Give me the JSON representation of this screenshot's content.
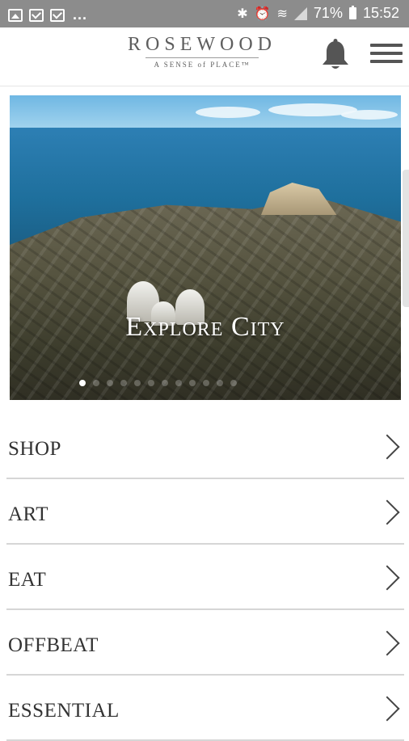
{
  "status_bar": {
    "more": "...",
    "battery": "71%",
    "time": "15:52"
  },
  "header": {
    "logo_main": "ROSEWOOD",
    "logo_tagline": "A SENSE of PLACE™"
  },
  "hero": {
    "title": "Explore City",
    "slide_count": 12,
    "active_slide": 1
  },
  "menu_items": [
    {
      "label": "SHOP"
    },
    {
      "label": "ART"
    },
    {
      "label": "EAT"
    },
    {
      "label": "OFFBEAT"
    },
    {
      "label": "ESSENTIAL"
    }
  ]
}
